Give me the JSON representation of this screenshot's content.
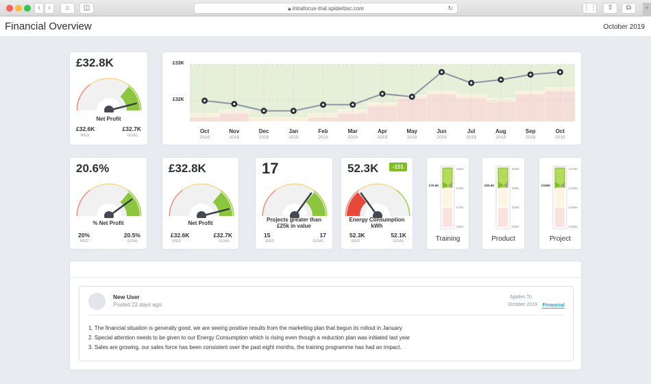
{
  "browser": {
    "url": "intrafocus-trial.spiderbsc.com",
    "buttons": [
      "back",
      "forward",
      "home",
      "sidebar",
      "grid",
      "share",
      "tabs",
      "new-tab"
    ]
  },
  "header": {
    "title": "Financial Overview",
    "period": "October 2019"
  },
  "net_profit_card": {
    "value": "£32.8K",
    "label": "Net Profit",
    "red": "£32.6K",
    "goal": "£32.7K",
    "red_label": "RED",
    "goal_label": "GOAL",
    "needle_fraction": 0.92
  },
  "chart_data": {
    "type": "line",
    "title": "",
    "ylabel": "",
    "yticks": [
      "£33K",
      "£32K"
    ],
    "ylim": [
      31.43,
      33.0
    ],
    "x": [
      "Oct 2018",
      "Nov 2018",
      "Dec 2018",
      "Jan 2019",
      "Feb 2019",
      "Mar 2019",
      "Apr 2019",
      "May 2019",
      "Jun 2019",
      "Jul 2019",
      "Aug 2019",
      "Sep 2019",
      "Oct 2019"
    ],
    "categories": [
      {
        "month": "Oct",
        "year": "2018"
      },
      {
        "month": "Nov",
        "year": "2018"
      },
      {
        "month": "Dec",
        "year": "2018"
      },
      {
        "month": "Jan",
        "year": "2019"
      },
      {
        "month": "Feb",
        "year": "2019"
      },
      {
        "month": "Mar",
        "year": "2019"
      },
      {
        "month": "Apr",
        "year": "2019"
      },
      {
        "month": "May",
        "year": "2019"
      },
      {
        "month": "Jun",
        "year": "2019"
      },
      {
        "month": "Jul",
        "year": "2019"
      },
      {
        "month": "Aug",
        "year": "2019"
      },
      {
        "month": "Sep",
        "year": "2019"
      },
      {
        "month": "Oct",
        "year": "2019"
      }
    ],
    "series": [
      {
        "name": "Net Profit",
        "values": [
          32.0,
          31.91,
          31.72,
          31.72,
          31.89,
          31.89,
          32.19,
          32.11,
          32.79,
          32.49,
          32.58,
          32.72,
          32.79
        ]
      },
      {
        "name": "Red threshold",
        "values": [
          31.53,
          31.64,
          31.43,
          31.43,
          31.53,
          31.64,
          31.85,
          32.06,
          32.17,
          32.06,
          31.96,
          32.17,
          32.26
        ]
      },
      {
        "name": "Goal",
        "values": [
          31.64,
          31.75,
          31.53,
          31.53,
          31.64,
          31.75,
          31.94,
          32.15,
          32.26,
          32.17,
          32.06,
          32.26,
          32.36
        ]
      }
    ],
    "colors": {
      "line": "#8a95a5",
      "marker": "#2b2f3a",
      "green_band": "#e6efd8",
      "amber_band": "#f8f0dc",
      "red_band": "#f5ddd8"
    },
    "grid": true
  },
  "gauges": [
    {
      "value": "20.6%",
      "label": "% Net Profit",
      "red": "20%",
      "goal": "20.5%",
      "needle_fraction": 0.8
    },
    {
      "value": "£32.8K",
      "label": "Net Profit",
      "red": "£32.6K",
      "goal": "£32.7K",
      "needle_fraction": 0.92
    },
    {
      "value": "17",
      "label": "Projects greater than £25k in value",
      "red": "15",
      "goal": "17",
      "needle_fraction": 0.7
    },
    {
      "value": "52.3K",
      "label": "Energy Consumption kWh",
      "red": "52.3K",
      "goal": "52.1K",
      "needle_fraction": 0.3,
      "badge": "-151"
    }
  ],
  "thermometers": [
    {
      "title": "Training",
      "marker": "£76.6K",
      "ticks": [
        "£80K",
        "£75K",
        "£70K",
        "£65K"
      ]
    },
    {
      "title": "Product",
      "marker": "£55.5K",
      "ticks": [
        "£60K",
        "£55K",
        "£50K",
        "£45K"
      ]
    },
    {
      "title": "Project",
      "marker": "£165K",
      "ticks": [
        "£170K",
        "£165K",
        "£160K",
        "£155K"
      ]
    }
  ],
  "labels": {
    "red": "RED",
    "goal": "GOAL"
  },
  "comment": {
    "user": "New User",
    "posted": "Posted 22 days ago",
    "applies_to_label": "Applies To",
    "applies_date": "October 2019",
    "applies_link": "Financial",
    "notes": [
      "1. The financial situation is generally good, we are seeing positive results from the marketing plan that begun its rollout in January",
      "2. Special attention needs to be given to our Energy Consumption which is rising even though a reduction plan was initiated last year",
      "3. Sales are growing, our sales force has been consistent over the past eight months, the training programme has had an impact."
    ]
  }
}
